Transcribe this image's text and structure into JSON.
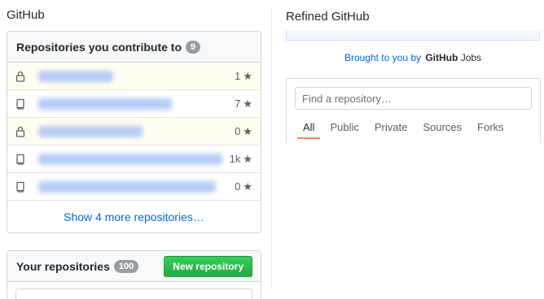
{
  "left_pane": {
    "title": "GitHub",
    "contribute": {
      "title": "Repositories you contribute to",
      "count": "9",
      "repos": [
        {
          "icon": "lock-icon",
          "private": true,
          "stars": "1"
        },
        {
          "icon": "repo-icon",
          "private": false,
          "stars": "7"
        },
        {
          "icon": "lock-icon",
          "private": true,
          "stars": "0"
        },
        {
          "icon": "repo-icon",
          "private": false,
          "stars": "1k"
        },
        {
          "icon": "repo-icon",
          "private": false,
          "stars": "0"
        }
      ],
      "show_more": "Show 4 more repositories…"
    },
    "your_repos": {
      "title": "Your repositories",
      "count": "100",
      "new_button": "New repository"
    }
  },
  "right_pane": {
    "title": "Refined GitHub",
    "brought_text": "Brought to you by",
    "brought_logo": "GitHub",
    "brought_jobs": "Jobs",
    "search_placeholder": "Find a repository…",
    "tabs": [
      "All",
      "Public",
      "Private",
      "Sources",
      "Forks"
    ],
    "active_tab": "All"
  },
  "colors": {
    "link": "#0366d6",
    "private_row": "#fffdef",
    "primary_button": "#2ea44f",
    "tab_underline": "#f9826c"
  }
}
